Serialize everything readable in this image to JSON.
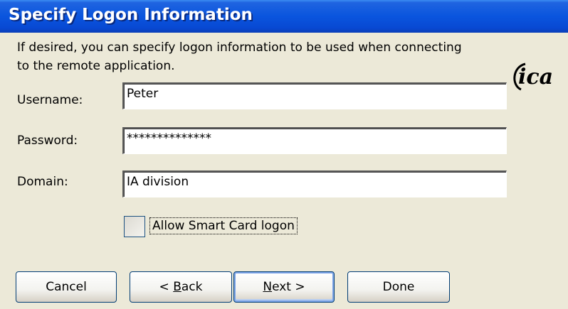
{
  "title": "Specify Logon Information",
  "description": "If desired, you can specify logon information to be used when connecting to the remote application.",
  "logo_text": "ica",
  "fields": {
    "username": {
      "label": "Username:",
      "value": "Peter"
    },
    "password": {
      "label": "Password:",
      "value": "**************"
    },
    "domain": {
      "label": "Domain:",
      "value": "IA division"
    }
  },
  "smart_card": {
    "label": "Allow Smart Card logon",
    "checked": false
  },
  "buttons": {
    "cancel": "Cancel",
    "back_prefix": "< ",
    "back_mnemonic": "B",
    "back_rest": "ack",
    "next_mnemonic": "N",
    "next_rest": "ext >",
    "done": "Done"
  },
  "colors": {
    "title_bar": "#0a55de",
    "dialog_bg": "#ece9d8"
  }
}
